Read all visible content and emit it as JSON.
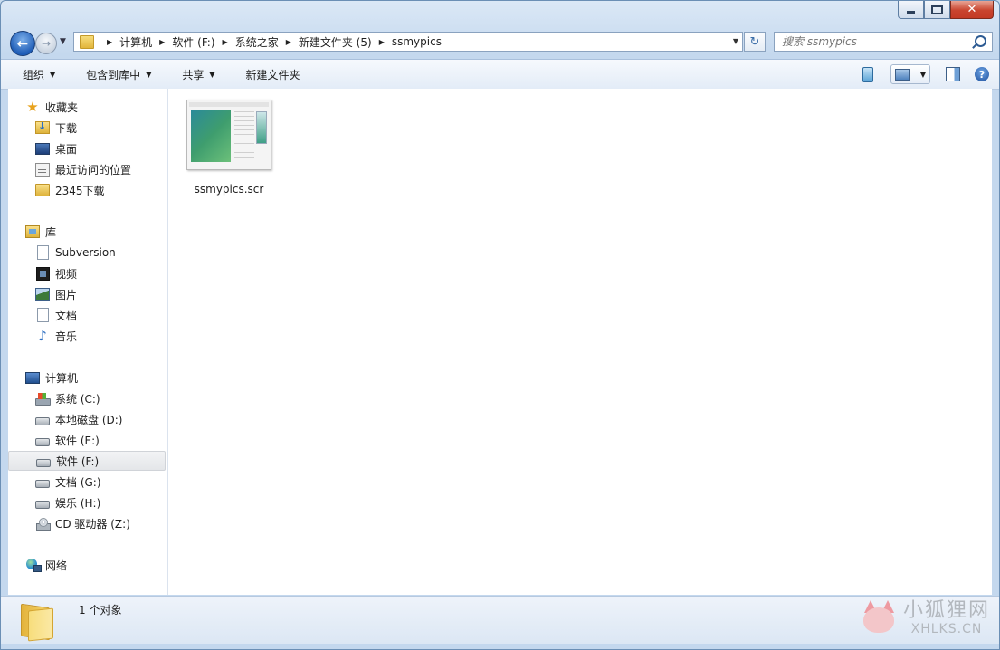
{
  "window": {
    "caption_buttons": {
      "minimize": "minimize",
      "maximize": "maximize",
      "close": "✕"
    }
  },
  "nav": {
    "back_glyph": "←",
    "forward_glyph": "→",
    "breadcrumb": [
      "计算机",
      "软件 (F:)",
      "系统之家",
      "新建文件夹 (5)",
      "ssmypics"
    ],
    "search_placeholder": "搜索 ssmypics",
    "refresh_glyph": "↻"
  },
  "toolbar": {
    "organize": "组织",
    "include_in_library": "包含到库中",
    "share": "共享",
    "new_folder": "新建文件夹",
    "help_glyph": "?"
  },
  "sidebar": {
    "favorites": {
      "label": "收藏夹",
      "items": [
        "下载",
        "桌面",
        "最近访问的位置",
        "2345下载"
      ]
    },
    "libraries": {
      "label": "库",
      "items": [
        "Subversion",
        "视频",
        "图片",
        "文档",
        "音乐"
      ]
    },
    "computer": {
      "label": "计算机",
      "items": [
        "系统 (C:)",
        "本地磁盘 (D:)",
        "软件 (E:)",
        "软件 (F:)",
        "文档 (G:)",
        "娱乐 (H:)",
        "CD 驱动器 (Z:)"
      ],
      "selected": "软件 (F:)"
    },
    "network": {
      "label": "网络"
    }
  },
  "files": [
    {
      "name": "ssmypics.scr"
    }
  ],
  "status": {
    "count_text": "1 个对象"
  },
  "watermark": {
    "cn": "小狐狸网",
    "en": "XHLKS.CN"
  },
  "colors": {
    "selection": "#e4e6e9",
    "frame": "#c4d8ee",
    "accent": "#1f5db7"
  }
}
